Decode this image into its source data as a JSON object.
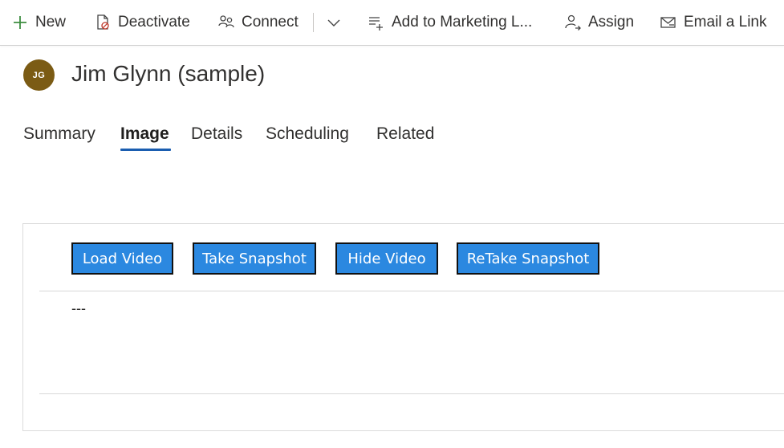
{
  "command_bar": {
    "new_label": "New",
    "deactivate_label": "Deactivate",
    "connect_label": "Connect",
    "add_to_marketing_list_label": "Add to Marketing L...",
    "assign_label": "Assign",
    "email_link_label": "Email a Link"
  },
  "record": {
    "avatar_initials": "JG",
    "avatar_color": "#7b5b14",
    "title": "Jim Glynn (sample)"
  },
  "tabs": [
    {
      "label": "Summary",
      "active": false
    },
    {
      "label": "Image",
      "active": true
    },
    {
      "label": "Details",
      "active": false
    },
    {
      "label": "Scheduling",
      "active": false
    },
    {
      "label": "Related",
      "active": false
    }
  ],
  "image_section": {
    "buttons": [
      {
        "label": "Load Video"
      },
      {
        "label": "Take Snapshot"
      },
      {
        "label": "Hide Video"
      },
      {
        "label": "ReTake Snapshot"
      }
    ],
    "empty_value": "---"
  },
  "colors": {
    "accent": "#1a5db0",
    "button_blue": "#2b88e0",
    "new_plus_green": "#3e8e41"
  }
}
